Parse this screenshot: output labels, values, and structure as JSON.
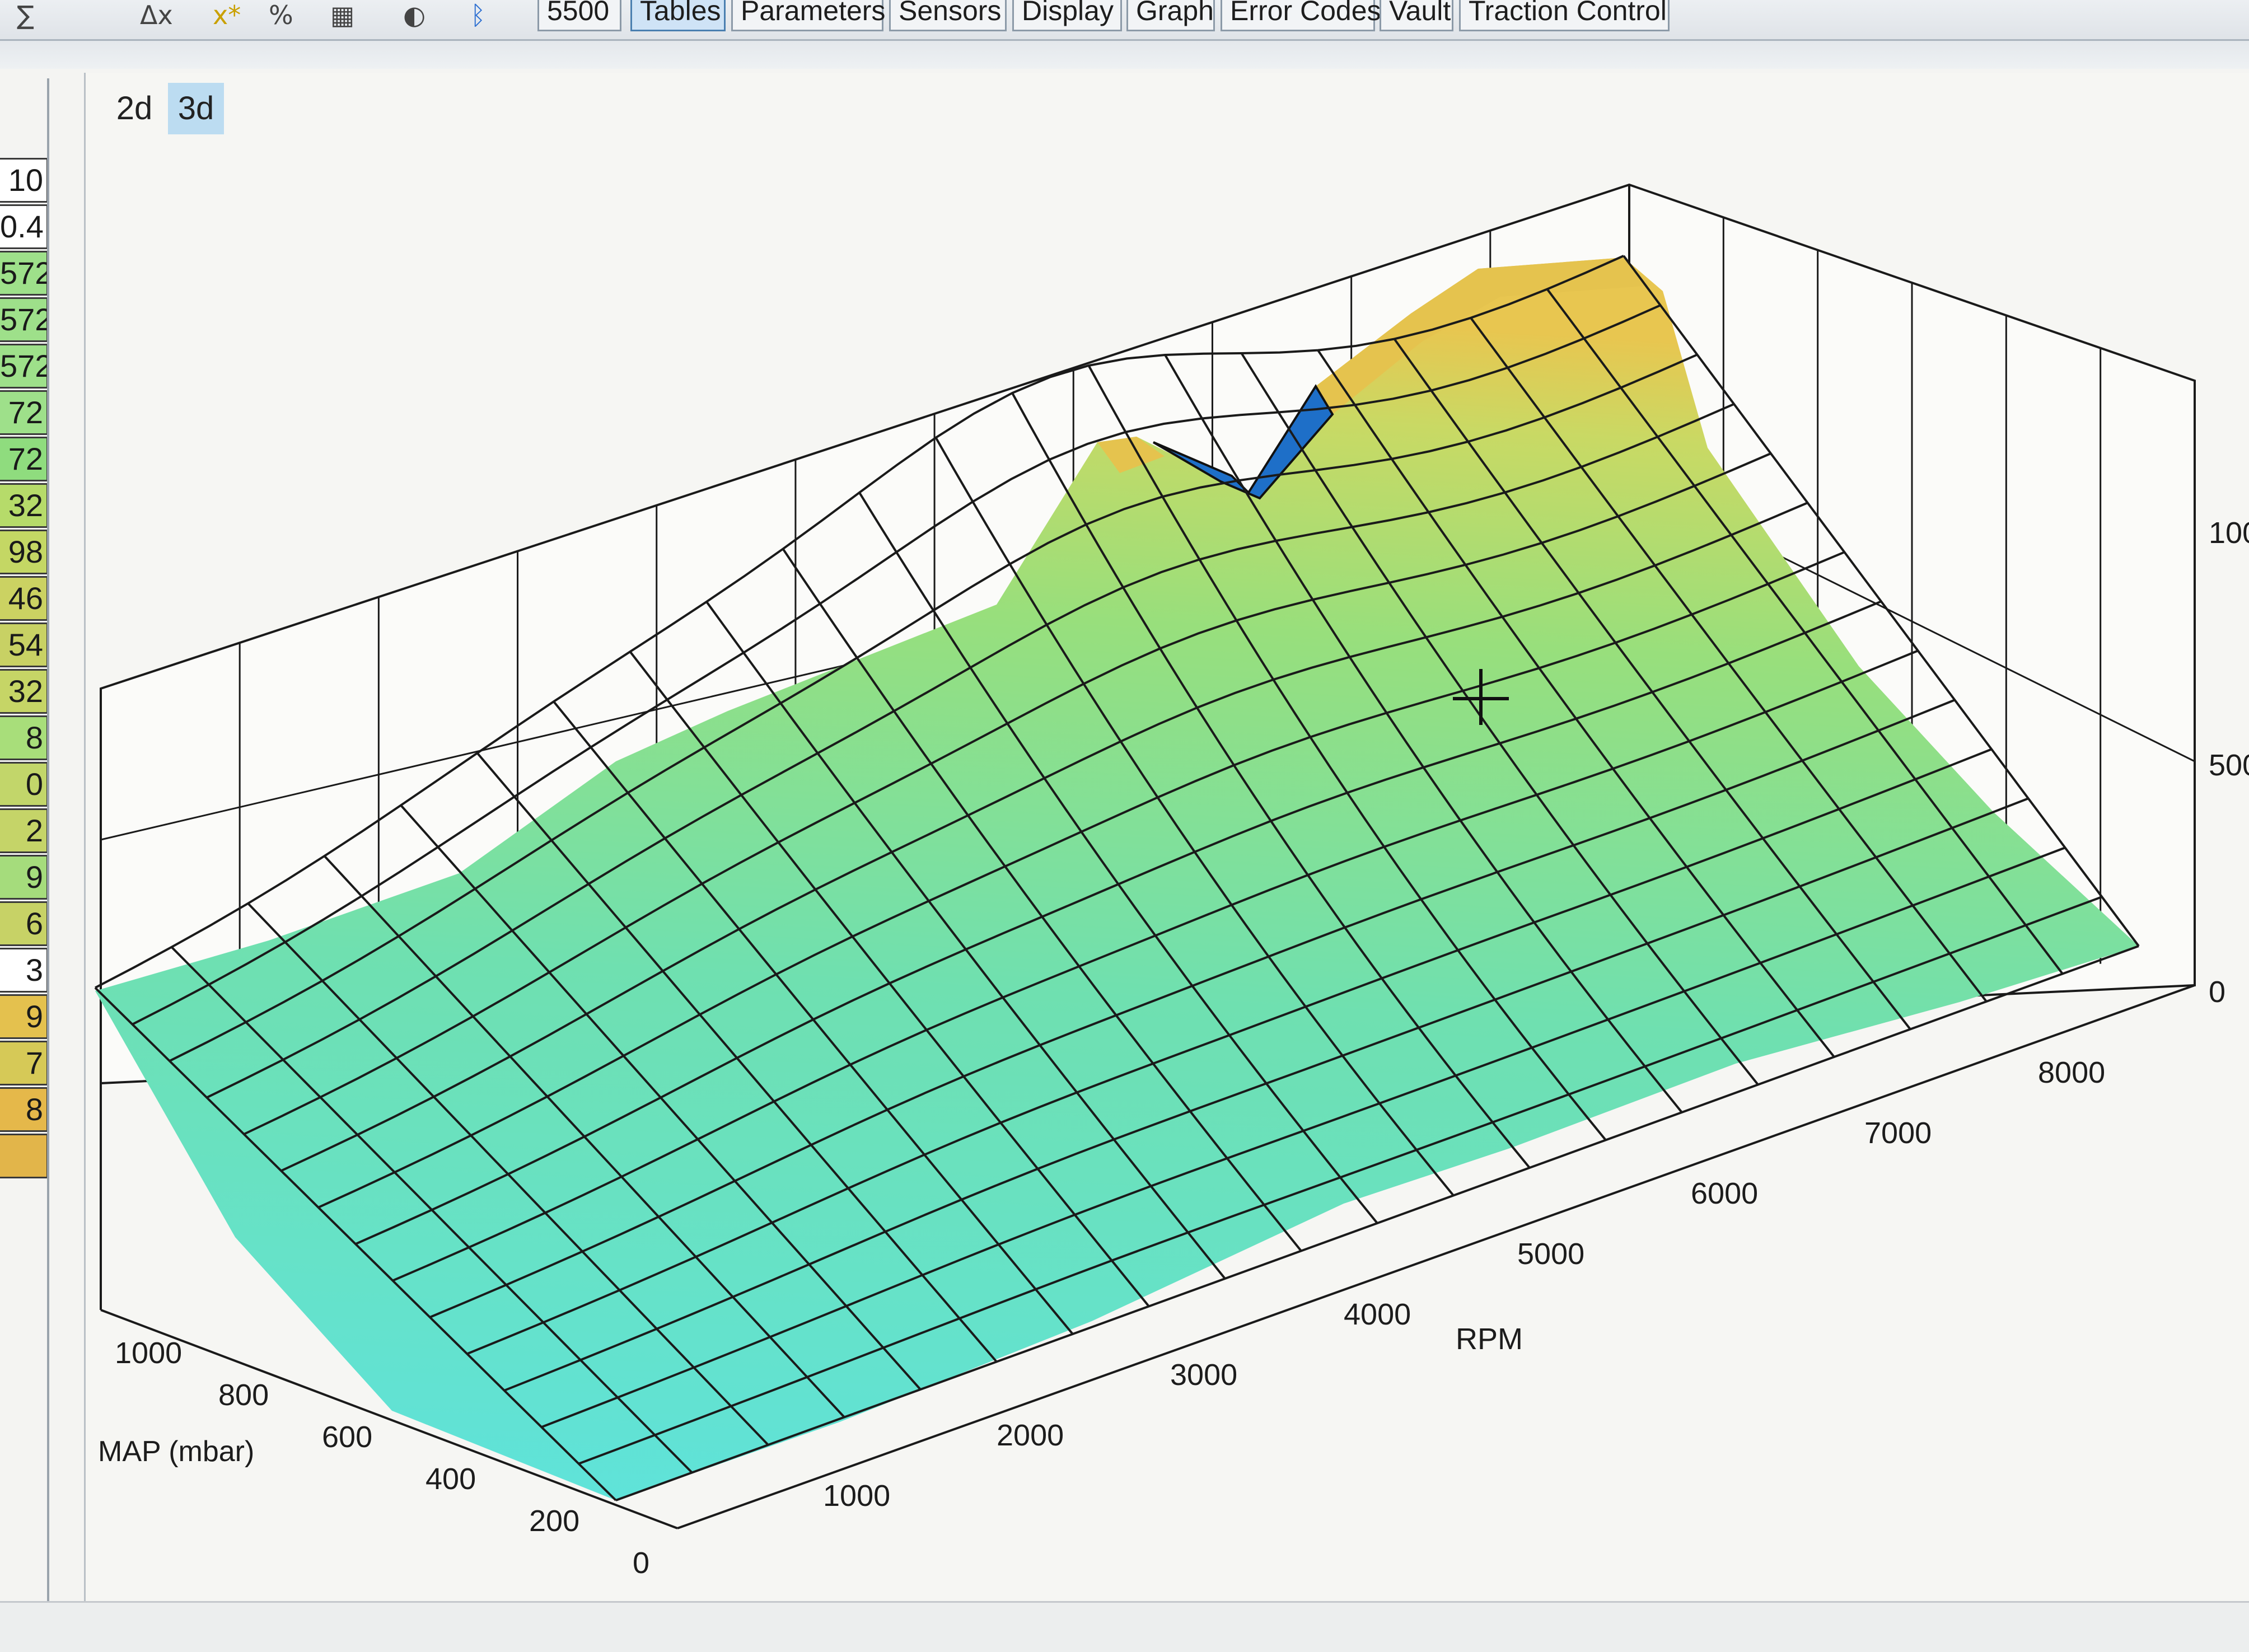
{
  "toolbar": {
    "icons": [
      "sigma-x-icon",
      "delta-x-icon",
      "x-star-icon",
      "percent-icon",
      "graph-icon",
      "gauge-icon",
      "bluetooth-icon"
    ],
    "rpm_box": "5500",
    "tabs": [
      "Tables",
      "Parameters",
      "Sensors",
      "Display",
      "Graph",
      "Error Codes",
      "Vault",
      "Traction Control"
    ],
    "active_tab": "Tables"
  },
  "view_toggle": {
    "options": [
      "2d",
      "3d"
    ],
    "active": "3d"
  },
  "left_cells": [
    {
      "text": "10",
      "color": "#ffffff"
    },
    {
      "text": "0.4",
      "color": "#ffffff"
    },
    {
      "text": "572",
      "color": "#9ee08a"
    },
    {
      "text": "572",
      "color": "#9ee08a"
    },
    {
      "text": "572",
      "color": "#9ee08a"
    },
    {
      "text": "72",
      "color": "#9ee08a"
    },
    {
      "text": "72",
      "color": "#8fdc7e"
    },
    {
      "text": "32",
      "color": "#b6db6a"
    },
    {
      "text": "98",
      "color": "#c4d764"
    },
    {
      "text": "46",
      "color": "#cbd262"
    },
    {
      "text": "54",
      "color": "#c8d164"
    },
    {
      "text": "32",
      "color": "#c6d566"
    },
    {
      "text": "8",
      "color": "#a8de7a"
    },
    {
      "text": "0",
      "color": "#c2d66a"
    },
    {
      "text": "2",
      "color": "#c5d468"
    },
    {
      "text": "9",
      "color": "#a5dc7c"
    },
    {
      "text": "6",
      "color": "#c7d266"
    },
    {
      "text": "3",
      "color": "#ffffff"
    },
    {
      "text": "9",
      "color": "#e4c14e"
    },
    {
      "text": "7",
      "color": "#d6c957"
    },
    {
      "text": "8",
      "color": "#e5b84a"
    },
    {
      "text": "",
      "color": "#e2b54a"
    }
  ],
  "chart_data": {
    "type": "surface",
    "x_axis": {
      "label": "RPM",
      "ticks": [
        "1000",
        "2000",
        "3000",
        "4000",
        "5000",
        "6000",
        "7000",
        "8000"
      ]
    },
    "y_axis": {
      "label": "MAP (mbar)",
      "ticks": [
        "0",
        "200",
        "400",
        "600",
        "800",
        "1000"
      ]
    },
    "z_axis": {
      "ticks": [
        "0",
        "500",
        "100"
      ]
    },
    "colors": {
      "low": "#5ee3dc",
      "mid": "#7fe08e",
      "high": "#e8c650",
      "peak": "#1e6fc8",
      "grid": "#1a1a1a"
    }
  }
}
